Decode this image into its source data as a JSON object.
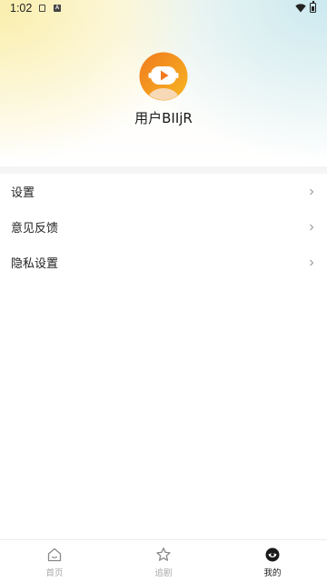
{
  "status_bar": {
    "time": "1:02",
    "icon2_letter": "A"
  },
  "profile": {
    "avatar_icon": "play-face-avatar",
    "username": "用户BIIjR"
  },
  "menu": {
    "items": [
      {
        "label": "设置"
      },
      {
        "label": "意见反馈"
      },
      {
        "label": "隐私设置"
      }
    ]
  },
  "bottom_nav": {
    "items": [
      {
        "label": "首页",
        "icon": "home-icon",
        "active": false
      },
      {
        "label": "追剧",
        "icon": "star-icon",
        "active": false
      },
      {
        "label": "我的",
        "icon": "profile-icon",
        "active": true
      }
    ]
  },
  "colors": {
    "accent_orange": "#F2841F",
    "avatar_yellow": "#F6B51E",
    "inactive_nav": "#AAAAAA",
    "active_nav": "#222222"
  }
}
